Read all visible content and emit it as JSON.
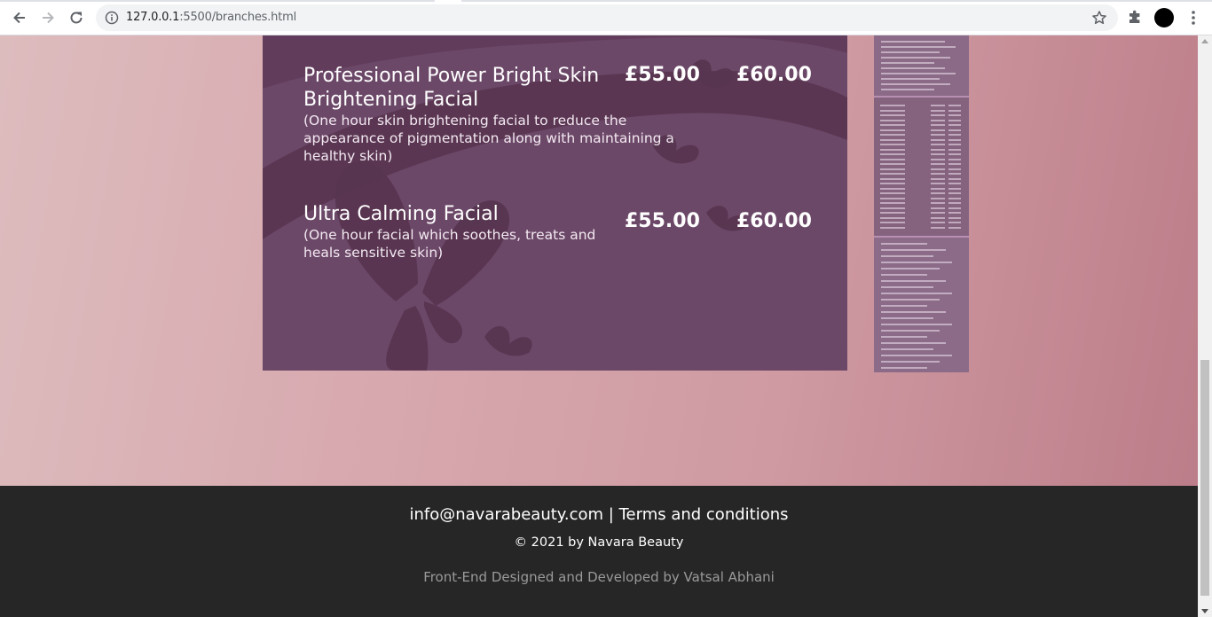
{
  "browser": {
    "url_host": "127.0.0.1",
    "url_path": ":5500/branches.html",
    "avatar_color": "#000000"
  },
  "menu": {
    "items": [
      {
        "name": "Professional Power Bright Skin Brightening Facial",
        "description": "(One hour skin brightening facial to reduce the appearance of pigmentation along with maintaining a healthy skin)",
        "price_1": "£55.00",
        "price_2": "£60.00"
      },
      {
        "name": "Ultra Calming Facial",
        "description": "(One hour facial which soothes, treats and heals sensitive skin)",
        "price_1": "£55.00",
        "price_2": "£60.00"
      }
    ],
    "background_color": "#6c4868"
  },
  "footer": {
    "email": "info@navarabeauty.com",
    "separator": "|",
    "terms": "Terms and conditions",
    "copyright": "© 2021 by Navara Beauty",
    "credit": "Front-End Designed and Developed by Vatsal Abhani",
    "background_color": "#262626"
  }
}
